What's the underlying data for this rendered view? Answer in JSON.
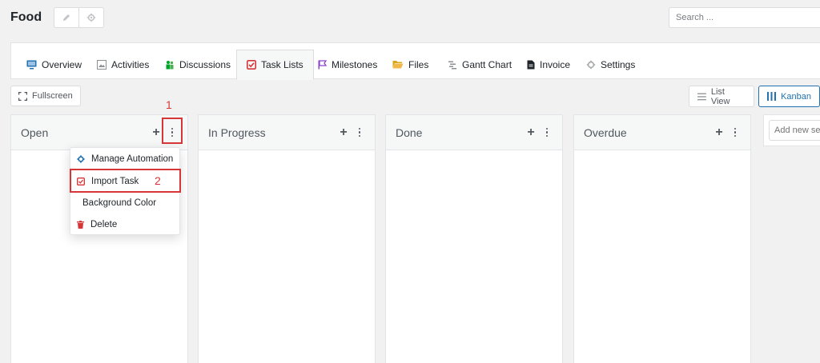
{
  "header": {
    "project_title": "Food",
    "search_placeholder": "Search ...",
    "edit_icon": "pencil-icon",
    "settings_icon": "gear-icon"
  },
  "tabs": [
    {
      "label": "Overview",
      "icon": "monitor-icon",
      "active": false
    },
    {
      "label": "Activities",
      "icon": "image-icon",
      "active": false
    },
    {
      "label": "Discussions",
      "icon": "people-icon",
      "active": false
    },
    {
      "label": "Task Lists",
      "icon": "checkbox-icon",
      "active": true
    },
    {
      "label": "Milestones",
      "icon": "flag-icon",
      "active": false
    },
    {
      "label": "Files",
      "icon": "folder-icon",
      "active": false
    },
    {
      "label": "Gantt Chart",
      "icon": "gantt-icon",
      "active": false
    },
    {
      "label": "Invoice",
      "icon": "document-icon",
      "active": false
    },
    {
      "label": "Settings",
      "icon": "gear-icon",
      "active": false
    }
  ],
  "toolbar": {
    "fullscreen_label": "Fullscreen",
    "list_view_label": "List View",
    "kanban_label": "Kanban"
  },
  "columns": [
    {
      "title": "Open",
      "add": "+"
    },
    {
      "title": "In Progress",
      "add": "+"
    },
    {
      "title": "Done",
      "add": "+"
    },
    {
      "title": "Overdue",
      "add": "+"
    }
  ],
  "add_section_placeholder": "Add new section",
  "column_menu": {
    "items": [
      {
        "label": "Manage Automation",
        "icon": "gear-icon"
      },
      {
        "label": "Import Task",
        "icon": "checkbox-icon"
      },
      {
        "label": "Background Color",
        "icon": ""
      },
      {
        "label": "Delete",
        "icon": "trash-icon"
      }
    ]
  },
  "annotations": {
    "step1": "1",
    "step2": "2"
  },
  "colors": {
    "accent": "#2271b1",
    "highlight": "#d63638",
    "background": "#f1f1f1"
  }
}
